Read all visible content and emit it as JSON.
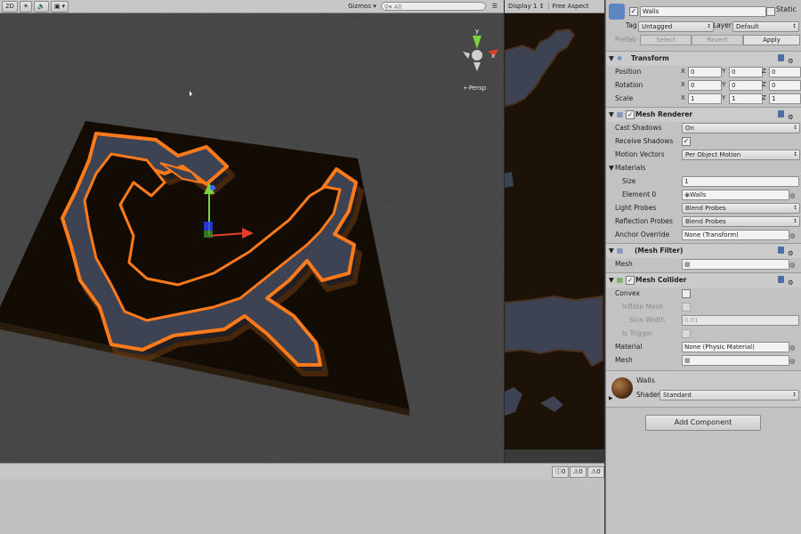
{
  "scene_toolbar": {
    "mode_2d": "2D",
    "gizmos_label": "Gizmos",
    "search_placeholder": "All"
  },
  "scene": {
    "persp_label": "Persp",
    "axis_y": "y",
    "axis_x": "x"
  },
  "game_toolbar": {
    "display": "Display 1",
    "aspect": "Free Aspect"
  },
  "console": {
    "info_count": "0",
    "warn_count": "0",
    "error_count": "0"
  },
  "inspector": {
    "object_name": "Walls",
    "static_label": "Static",
    "tag_label": "Tag",
    "tag_value": "Untagged",
    "layer_label": "Layer",
    "layer_value": "Default",
    "prefab_label": "Prefab",
    "prefab_select": "Select",
    "prefab_revert": "Revert",
    "prefab_apply": "Apply",
    "transform": {
      "title": "Transform",
      "position_label": "Position",
      "position": [
        "0",
        "0",
        "0"
      ],
      "rotation_label": "Rotation",
      "rotation": [
        "0",
        "0",
        "0"
      ],
      "scale_label": "Scale",
      "scale": [
        "1",
        "1",
        "1"
      ]
    },
    "mesh_renderer": {
      "title": "Mesh Renderer",
      "cast_shadows_label": "Cast Shadows",
      "cast_shadows": "On",
      "receive_shadows_label": "Receive Shadows",
      "motion_vectors_label": "Motion Vectors",
      "motion_vectors": "Per Object Motion",
      "materials_label": "Materials",
      "size_label": "Size",
      "size": "1",
      "element0_label": "Element 0",
      "element0": "Walls",
      "light_probes_label": "Light Probes",
      "light_probes": "Blend Probes",
      "reflection_probes_label": "Reflection Probes",
      "reflection_probes": "Blend Probes",
      "anchor_override_label": "Anchor Override",
      "anchor_override": "None (Transform)"
    },
    "mesh_filter": {
      "title": "(Mesh Filter)",
      "mesh_label": "Mesh"
    },
    "mesh_collider": {
      "title": "Mesh Collider",
      "convex_label": "Convex",
      "inflate_mesh_label": "Inflate Mesh",
      "skin_width_label": "Skin Width",
      "skin_width": "0.01",
      "is_trigger_label": "Is Trigger",
      "material_label": "Material",
      "material": "None (Physic Material)",
      "mesh_label": "Mesh"
    },
    "material": {
      "name": "Walls",
      "shader_label": "Shader",
      "shader": "Standard"
    },
    "add_component": "Add Component"
  },
  "colors": {
    "outline": "#ff7a1a",
    "floor": "#120c05",
    "wall": "#3d4352",
    "panel": "#c2c2c2"
  }
}
